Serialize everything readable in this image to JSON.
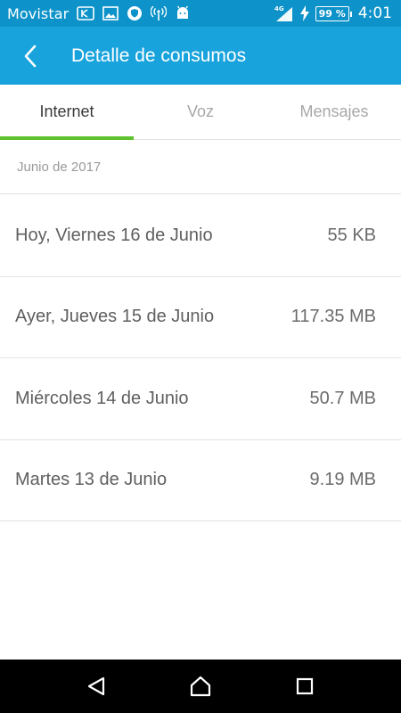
{
  "status_bar": {
    "carrier": "Movistar",
    "network_type": "4G",
    "battery_percent": "99 %",
    "time": "4:01",
    "icons": [
      "notification-icon",
      "image-icon",
      "shield-icon",
      "hotspot-icon",
      "android-icon",
      "signal-icon",
      "charging-icon",
      "battery-icon"
    ]
  },
  "app_bar": {
    "title": "Detalle de consumos",
    "back_icon": "chevron-left-icon"
  },
  "tabs": [
    {
      "label": "Internet",
      "active": true
    },
    {
      "label": "Voz",
      "active": false
    },
    {
      "label": "Mensajes",
      "active": false
    }
  ],
  "month_header": "Junio de 2017",
  "usage": [
    {
      "day": "Hoy, Viernes 16 de Junio",
      "amount": "55 KB"
    },
    {
      "day": "Ayer, Jueves 15 de Junio",
      "amount": "117.35 MB"
    },
    {
      "day": "Miércoles 14 de Junio",
      "amount": "50.7 MB"
    },
    {
      "day": "Martes 13 de Junio",
      "amount": "9.19 MB"
    }
  ],
  "colors": {
    "status_bar": "#0d93c9",
    "app_bar": "#19a3dd",
    "active_tab_indicator": "#5ec22c"
  },
  "nav_bar": {
    "icons": [
      "back-triangle-icon",
      "home-icon",
      "recents-square-icon"
    ]
  }
}
